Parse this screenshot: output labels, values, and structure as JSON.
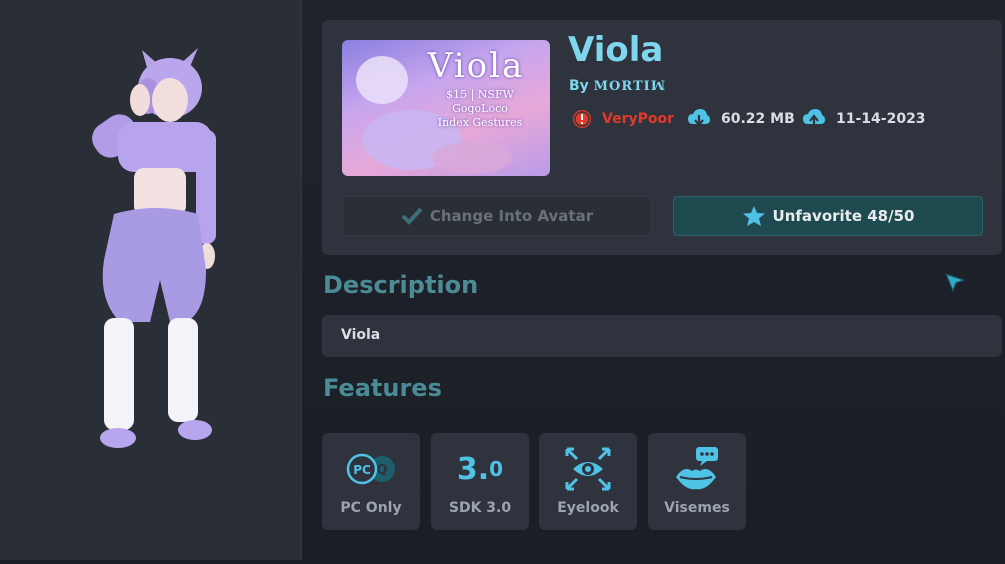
{
  "avatar": {
    "name": "Viola",
    "author_prefix": "By",
    "author": "MORTIꟽ",
    "performance": "VeryPoor",
    "file_size": "60.22 MB",
    "updated": "11-14-2023"
  },
  "thumbnail": {
    "title": "Viola",
    "line2": "$15 | NSFW",
    "line3": "GogoLoco",
    "line4": "Index Gestures"
  },
  "actions": {
    "change_label": "Change Into Avatar",
    "unfavorite_label": "Unfavorite 48/50"
  },
  "description": {
    "heading": "Description",
    "text": "Viola"
  },
  "features": {
    "heading": "Features",
    "items": [
      {
        "label": "PC Only",
        "icon": "pc-quest-icon"
      },
      {
        "label": "SDK 3.0",
        "icon": "sdk-icon",
        "big": "3.",
        "small": "0"
      },
      {
        "label": "Eyelook",
        "icon": "eye-icon"
      },
      {
        "label": "Visemes",
        "icon": "lips-speech-icon"
      }
    ]
  },
  "colors": {
    "accent": "#7fd6ee",
    "icon": "#4fc3e6",
    "heading": "#4a8b96",
    "perf_bad": "#e03a2a",
    "unfavorite_bg": "#1f4a50"
  }
}
